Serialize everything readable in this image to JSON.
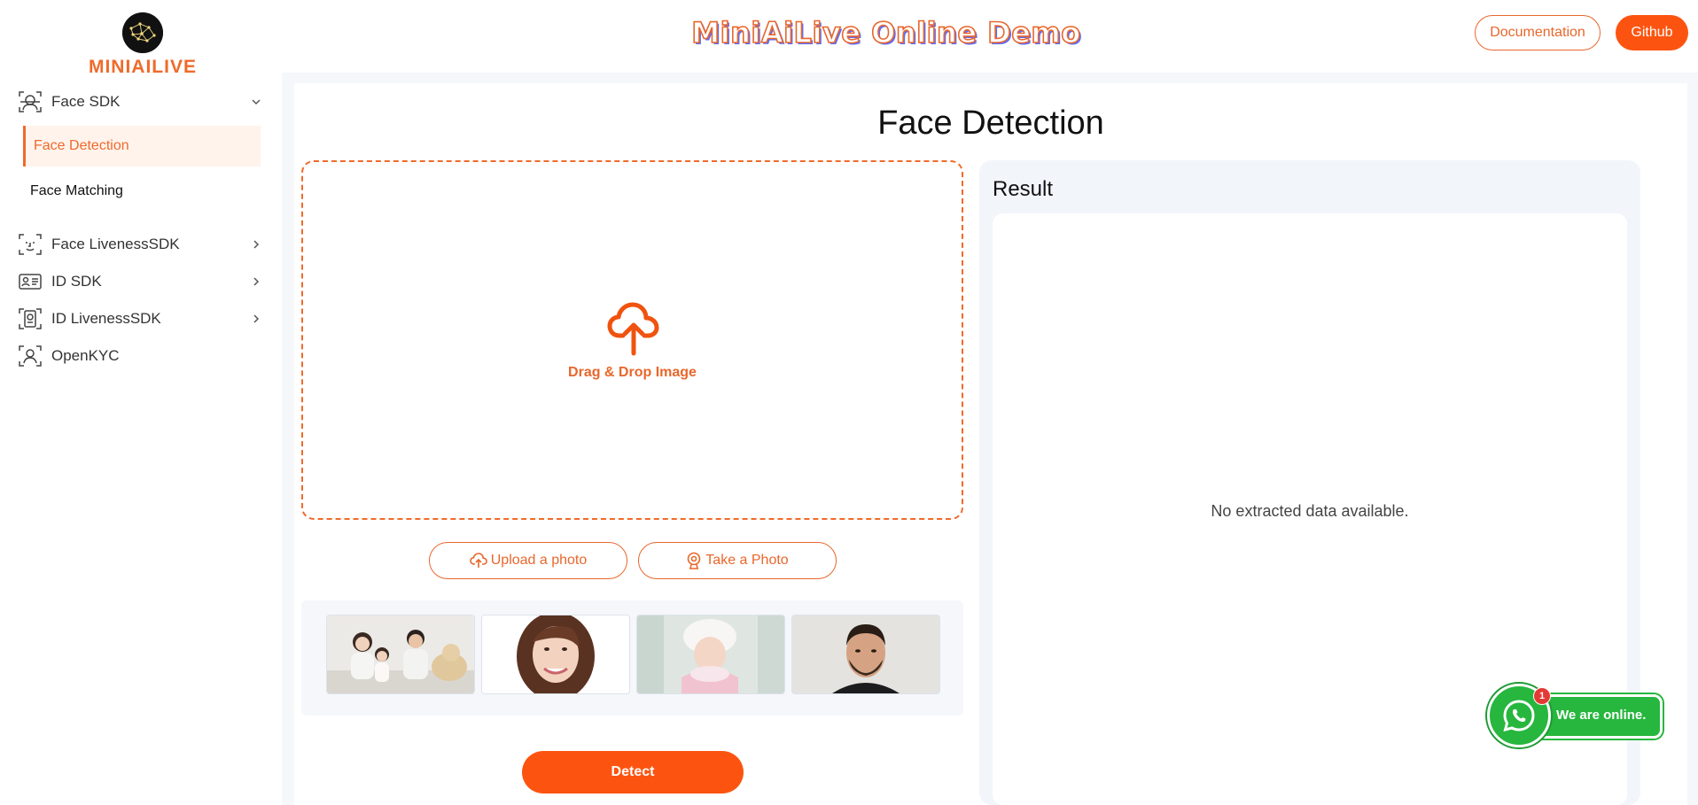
{
  "header": {
    "logo_text": "MINIAILIVE",
    "site_title": "MiniAiLive Online Demo",
    "documentation_label": "Documentation",
    "github_label": "Github"
  },
  "sidebar": {
    "groups": [
      {
        "label": "Face SDK",
        "icon": "face-scan-icon",
        "expanded": true,
        "items": [
          {
            "label": "Face Detection",
            "active": true
          },
          {
            "label": "Face Matching",
            "active": false
          }
        ]
      },
      {
        "label": "Face LivenessSDK",
        "icon": "face-liveness-icon",
        "expanded": false
      },
      {
        "label": "ID SDK",
        "icon": "id-card-icon",
        "expanded": false
      },
      {
        "label": "ID LivenessSDK",
        "icon": "passport-icon",
        "expanded": false
      },
      {
        "label": "OpenKYC",
        "icon": "user-frame-icon",
        "expanded": false
      }
    ]
  },
  "main": {
    "page_title": "Face Detection",
    "dropzone_text": "Drag & Drop Image",
    "upload_label": "Upload a photo",
    "take_photo_label": "Take a Photo",
    "detect_label": "Detect",
    "sample_images": [
      "family-photo",
      "smiling-woman-photo",
      "woman-in-winter-hat-photo",
      "bearded-man-photo"
    ]
  },
  "result": {
    "title": "Result",
    "empty_message": "No extracted data available."
  },
  "chat_widget": {
    "label": "We are online.",
    "badge_count": "1"
  },
  "colors": {
    "accent": "#fc5410",
    "accent_text": "#e8672c",
    "active_bg": "#fff3ec",
    "panel_bg": "#f2f5fa",
    "whatsapp": "#27b63e"
  }
}
